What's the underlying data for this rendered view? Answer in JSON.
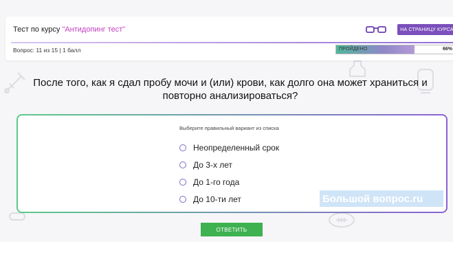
{
  "header": {
    "course_prefix": "Тест по курсу ",
    "course_name": "\"Антидопинг тест\"",
    "course_button": "НА СТРАНИЦУ КУРСА",
    "icon": "glasses-icon",
    "counter": "Вопрос: 11 из 15 | 1 балл",
    "progress_label": "ПРОЙДЕНО",
    "progress_percent": "66%",
    "progress_fraction": 0.66
  },
  "question": {
    "text": "После того, как я сдал пробу мочи и (или) крови, как долго она может храниться и повторно анализироваться?"
  },
  "answers": {
    "instruction": "Выберите правильный вариант из списка",
    "options": [
      "Неопределенный срок",
      "До 3-х лет",
      "До 1-го года",
      "До 10-ти лет"
    ]
  },
  "submit_label": "ОТВЕТИТЬ",
  "watermark": {
    "text": "Большой вопрос",
    "suffix": ".ru"
  },
  "colors": {
    "accent": "#7b4fbb",
    "course_name": "#c43fbf",
    "submit": "#3eb151"
  }
}
